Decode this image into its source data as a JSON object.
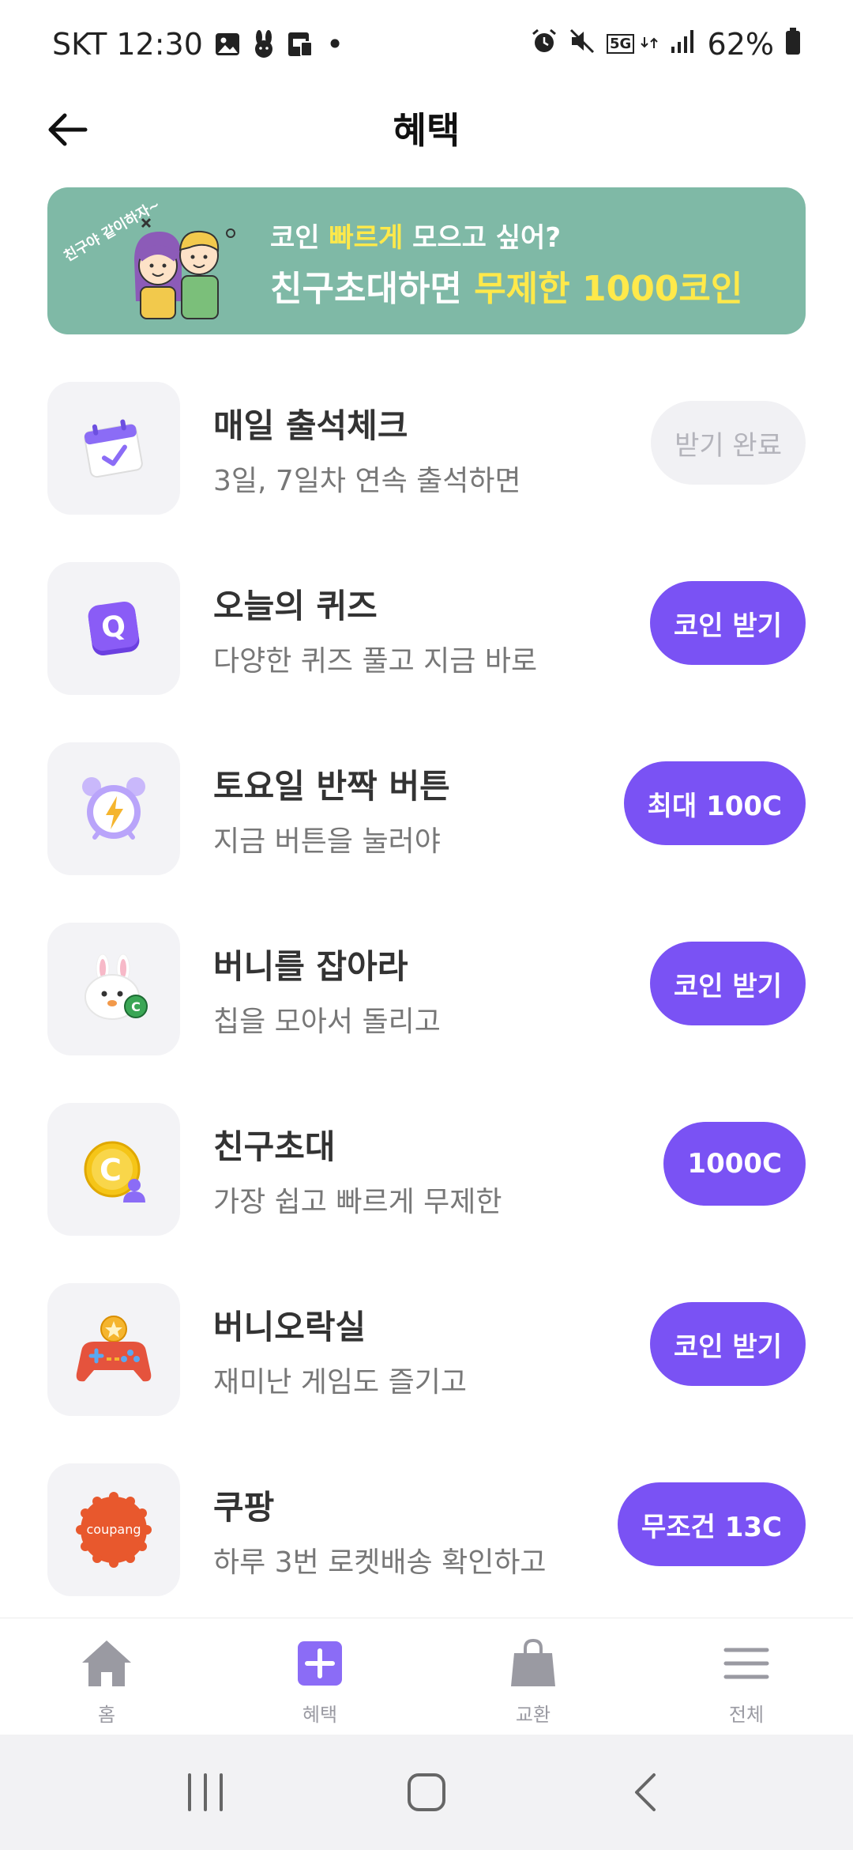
{
  "status_bar": {
    "carrier_time": "SKT 12:30",
    "dot": "•",
    "network": "5G",
    "battery": "62%"
  },
  "header": {
    "title": "혜택"
  },
  "banner": {
    "art_text": "친구야 같이하자~",
    "line1_a": "코인 ",
    "line1_hl": "빠르게",
    "line1_b": " 모으고 싶어?",
    "line2_a": "친구초대하면 ",
    "line2_hl": "무제한 1000코인"
  },
  "items": [
    {
      "title": "매일 출석체크",
      "sub": "3일, 7일차 연속 출석하면",
      "cta": "받기 완료",
      "icon": "calendar-check-icon"
    },
    {
      "title": "오늘의 퀴즈",
      "sub": "다양한 퀴즈 풀고 지금 바로",
      "cta": "코인 받기",
      "icon": "quiz-q-icon"
    },
    {
      "title": "토요일 반짝 버튼",
      "sub": "지금 버튼을 눌러야",
      "cta": "최대 100C",
      "icon": "alarm-clock-icon"
    },
    {
      "title": "버니를 잡아라",
      "sub": "칩을 모아서 돌리고",
      "cta": "코인 받기",
      "icon": "bunny-icon"
    },
    {
      "title": "친구초대",
      "sub": "가장 쉽고 빠르게 무제한",
      "cta": "1000C",
      "icon": "coin-person-icon"
    },
    {
      "title": "버니오락실",
      "sub": "재미난 게임도 즐기고",
      "cta": "코인 받기",
      "icon": "gamepad-icon"
    },
    {
      "title": "쿠팡",
      "sub": "하루 3번 로켓배송 확인하고",
      "cta": "무조건 13C",
      "icon": "coupang-logo-icon",
      "logo_text": "coupang"
    }
  ],
  "bottom_nav": [
    {
      "label": "홈",
      "icon": "home-icon"
    },
    {
      "label": "혜택",
      "icon": "plus-square-icon"
    },
    {
      "label": "교환",
      "icon": "shopping-bag-icon"
    },
    {
      "label": "전체",
      "icon": "menu-icon"
    }
  ],
  "colors": {
    "accent": "#7a52f4",
    "banner_bg": "#7fb9a6",
    "highlight": "#ffe94a"
  }
}
